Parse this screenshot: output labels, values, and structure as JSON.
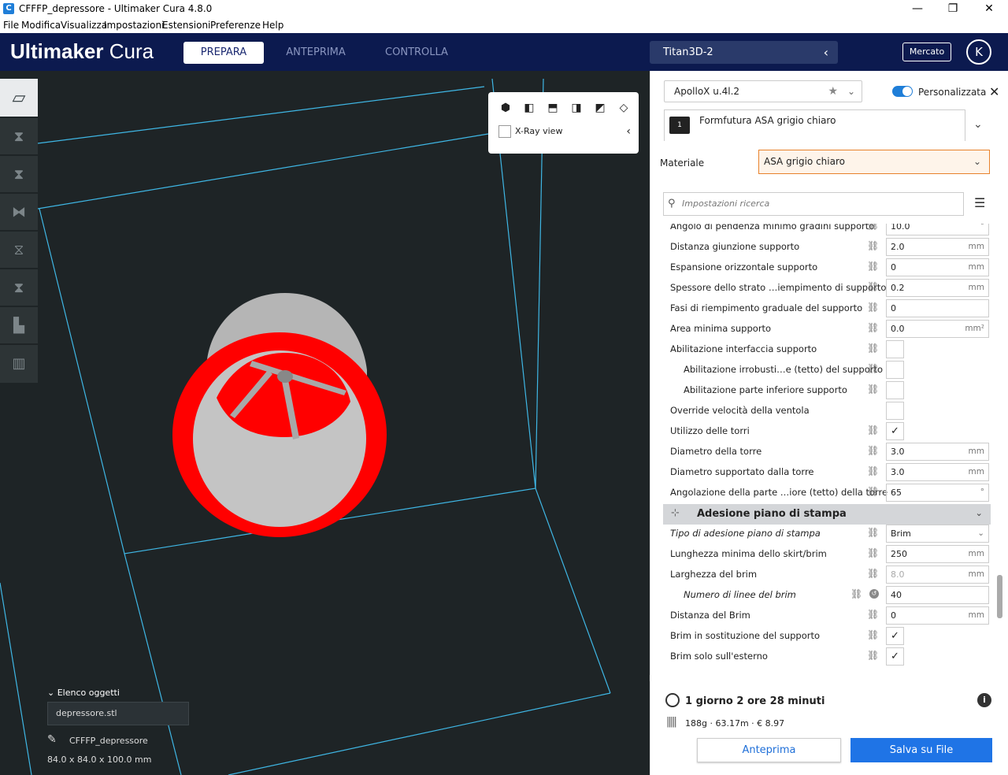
{
  "window": {
    "title": "CFFFP_depressore - Ultimaker Cura 4.8.0",
    "app_icon": "C",
    "controls": {
      "minimize": "—",
      "maximize": "❐",
      "close": "✕"
    }
  },
  "menu": [
    "File",
    "Modifica",
    "Visualizza",
    "Impostazioni",
    "Estensioni",
    "Preferenze",
    "Help"
  ],
  "header": {
    "brand_bold": "Ultimaker",
    "brand_light": "Cura",
    "tabs": [
      "PREPARA",
      "ANTEPRIMA",
      "CONTROLLA"
    ],
    "machine": "Titan3D-2",
    "market": "Mercato",
    "account_initial": "K"
  },
  "view": {
    "xray_label": "X-Ray view",
    "model_colors": {
      "part": "#ff0000",
      "body": "#b5b5b5",
      "build_volume": "#3fb7e5"
    }
  },
  "objects": {
    "toggle_label": "Elenco oggetti",
    "file": "depressore.stl",
    "name": "CFFFP_depressore",
    "dims": "84.0 x 84.0 x 100.0 mm"
  },
  "panel": {
    "printer": "ApolloX u.4l.2",
    "custom_label": "Personalizzata",
    "extruder_number": "1",
    "extruder_material": "Formfutura ASA grigio chiaro",
    "material_label": "Materiale",
    "material_value": "ASA grigio chiaro",
    "search_placeholder": "Impostazioni ricerca"
  },
  "settings": [
    {
      "label": "Angolo di pendenza minimo gradini supporto",
      "value": "10.0",
      "unit": "°"
    },
    {
      "label": "Distanza giunzione supporto",
      "value": "2.0",
      "unit": "mm"
    },
    {
      "label": "Espansione orizzontale supporto",
      "value": "0",
      "unit": "mm"
    },
    {
      "label": "Spessore dello strato …iempimento di supporto",
      "value": "0.2",
      "unit": "mm"
    },
    {
      "label": "Fasi di riempimento graduale del supporto",
      "value": "0",
      "unit": ""
    },
    {
      "label": "Area minima supporto",
      "value": "0.0",
      "unit": "mm²"
    },
    {
      "label": "Abilitazione interfaccia supporto",
      "check": ""
    },
    {
      "label": "Abilitazione irrobusti…e (tetto) del supporto",
      "check": "",
      "indent": true
    },
    {
      "label": "Abilitazione parte inferiore supporto",
      "check": "",
      "indent": true
    },
    {
      "label": "Override velocità della ventola",
      "check": "",
      "nolink": true
    },
    {
      "label": "Utilizzo delle torri",
      "check": "✓"
    },
    {
      "label": "Diametro della torre",
      "value": "3.0",
      "unit": "mm"
    },
    {
      "label": "Diametro supportato dalla torre",
      "value": "3.0",
      "unit": "mm"
    },
    {
      "label": "Angolazione della parte …iore (tetto) della torre",
      "value": "65",
      "unit": "°"
    }
  ],
  "adhesion": {
    "category": "Adesione piano di stampa",
    "rows": [
      {
        "label": "Tipo di adesione piano di stampa",
        "value": "Brim",
        "dropdown": true,
        "italic": true
      },
      {
        "label": "Lunghezza minima dello skirt/brim",
        "value": "250",
        "unit": "mm"
      },
      {
        "label": "Larghezza del brim",
        "value": "8.0",
        "unit": "mm",
        "disabled": true
      },
      {
        "label": "Numero di linee del brim",
        "value": "40",
        "unit": "",
        "italic": true,
        "indent": true,
        "reset": true
      },
      {
        "label": "Distanza del Brim",
        "value": "0",
        "unit": "mm"
      },
      {
        "label": "Brim in sostituzione del supporto",
        "check": "✓"
      },
      {
        "label": "Brim solo sull'esterno",
        "check": "✓"
      }
    ]
  },
  "estimate": {
    "time": "1 giorno 2 ore 28 minuti",
    "stats": "188g · 63.17m · € 8.97",
    "preview_button": "Anteprima",
    "save_button": "Salva su File"
  }
}
